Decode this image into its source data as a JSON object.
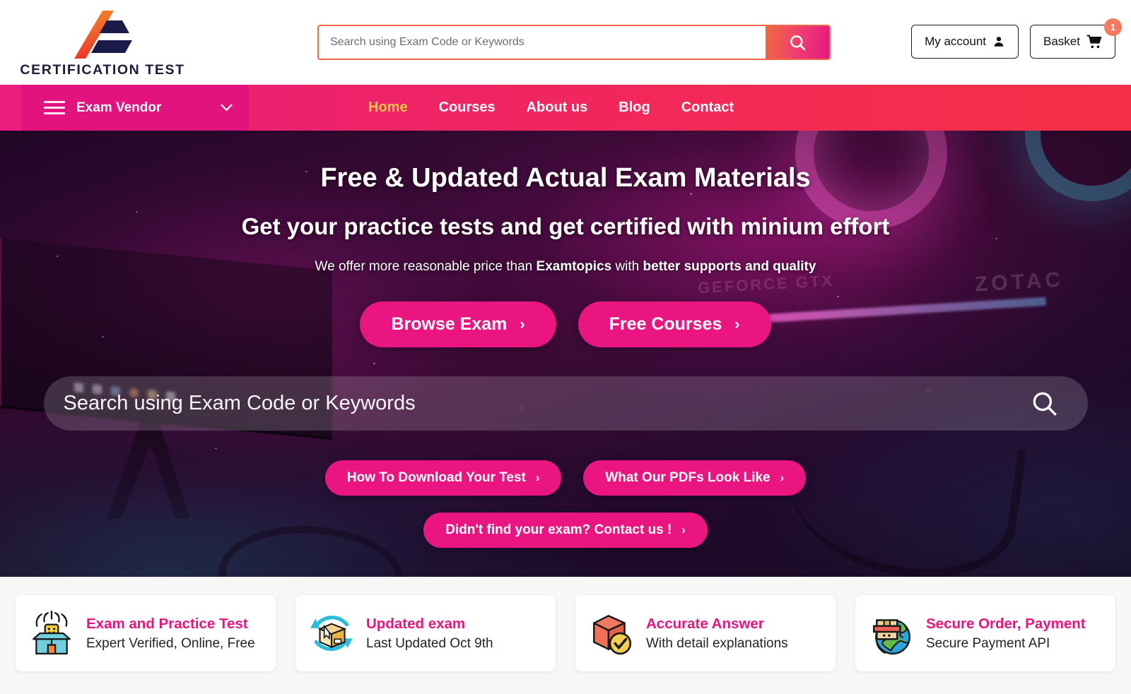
{
  "brand": {
    "name": "CERTIFICATION TEST",
    "logo_icon": "triangle-logo-icon",
    "accent_pink": "#ea1580",
    "accent_orange": "#f2694a",
    "nav_active_color": "#f7c748"
  },
  "header": {
    "search": {
      "placeholder": "Search using Exam Code or Keywords",
      "value": "",
      "button_icon": "search-icon"
    },
    "account_button": {
      "label": "My account",
      "icon": "user-icon"
    },
    "basket_button": {
      "label": "Basket",
      "icon": "cart-icon",
      "badge": "1"
    }
  },
  "nav": {
    "vendor_dropdown": {
      "label": "Exam Vendor",
      "menu_icon": "hamburger-icon",
      "chevron_icon": "chevron-down-icon"
    },
    "links": [
      {
        "label": "Home",
        "active": true
      },
      {
        "label": "Courses",
        "active": false
      },
      {
        "label": "About us",
        "active": false
      },
      {
        "label": "Blog",
        "active": false
      },
      {
        "label": "Contact",
        "active": false
      }
    ]
  },
  "hero": {
    "headline": "Free & Updated Actual Exam Materials",
    "subheadline": "Get your practice tests and get certified with minium effort",
    "tagline": {
      "part1": "We offer more reasonable price than ",
      "bold1": "Examtopics",
      "part2": " with ",
      "bold2": "better supports and quality"
    },
    "primary_buttons": [
      {
        "label": "Browse Exam",
        "icon": "chevron-right-icon"
      },
      {
        "label": "Free Courses",
        "icon": "chevron-right-icon"
      }
    ],
    "search": {
      "placeholder": "Search using Exam Code or Keywords",
      "value": "",
      "icon": "search-icon"
    },
    "secondary_buttons": [
      {
        "label": "How To Download Your Test",
        "icon": "chevron-right-icon"
      },
      {
        "label": "What Our PDFs Look Like",
        "icon": "chevron-right-icon"
      }
    ],
    "tertiary_button": {
      "label": "Didn't find your exam? Contact us !",
      "icon": "chevron-right-icon"
    }
  },
  "features": [
    {
      "icon": "surprise-box-icon",
      "title": "Exam and Practice Test",
      "subtitle": "Expert Verified, Online, Free"
    },
    {
      "icon": "refresh-package-icon",
      "title": "Updated exam",
      "subtitle": "Last Updated Oct 9th"
    },
    {
      "icon": "verified-cube-icon",
      "title": "Accurate Answer",
      "subtitle": "With detail explanations"
    },
    {
      "icon": "globe-package-icon",
      "title": "Secure Order, Payment",
      "subtitle": "Secure Payment API"
    }
  ]
}
